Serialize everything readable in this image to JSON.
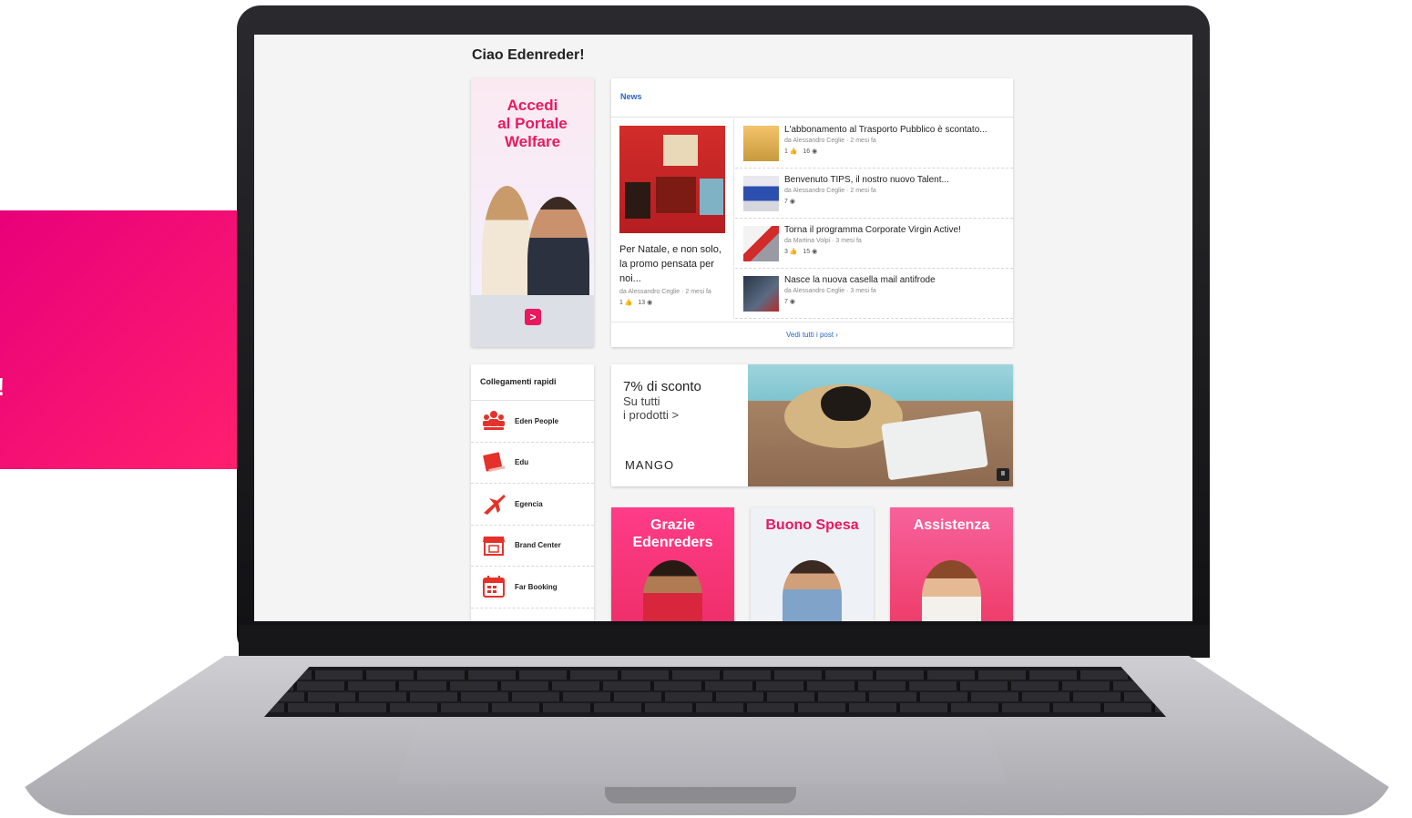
{
  "left_banner": {
    "text": "!"
  },
  "greeting": "Ciao Edenreder!",
  "welfare_banner": {
    "title": "Accedi\nal Portale\nWelfare",
    "arrow": ">"
  },
  "news": {
    "header": "News",
    "featured": {
      "title": "Per Natale, e non solo, la promo pensata per noi...",
      "meta": "da Alessandro Ceglie · 2 mesi fa",
      "likes": "1",
      "views": "13"
    },
    "items": [
      {
        "title": "L'abbonamento al Trasporto Pubblico è scontato...",
        "meta": "da Alessandro Ceglie · 2 mesi fa",
        "likes": "1",
        "views": "16"
      },
      {
        "title": "Benvenuto TIPS, il nostro nuovo Talent...",
        "meta": "da Alessandro Ceglie · 2 mesi fa",
        "likes": "",
        "views": "7"
      },
      {
        "title": "Torna il programma Corporate Virgin Active!",
        "meta": "da Martina Volpi · 3 mesi fa",
        "likes": "3",
        "views": "15"
      },
      {
        "title": "Nasce la nuova casella mail antifrode",
        "meta": "da Alessandro Ceglie · 3 mesi fa",
        "likes": "",
        "views": "7"
      }
    ],
    "footer": "Vedi tutti i post ›"
  },
  "quick_links": {
    "header": "Collegamenti rapidi",
    "items": [
      {
        "label": "Eden People",
        "icon": "people-icon"
      },
      {
        "label": "Edu",
        "icon": "book-icon"
      },
      {
        "label": "Egencia",
        "icon": "airplane-icon"
      },
      {
        "label": "Brand Center",
        "icon": "store-icon"
      },
      {
        "label": "Far Booking",
        "icon": "calendar-icon"
      }
    ]
  },
  "promo": {
    "headline": "7% di sconto",
    "sub": "Su tutti\ni prodotti >",
    "brand": "MANGO",
    "pause": "II"
  },
  "tiles": [
    {
      "title": "Grazie\nEdenreders"
    },
    {
      "title": "Buono Spesa"
    },
    {
      "title": "Assistenza"
    }
  ],
  "colors": {
    "brand_pink": "#e8195e",
    "link_blue": "#2a63c4",
    "icon_red": "#e4322b"
  }
}
